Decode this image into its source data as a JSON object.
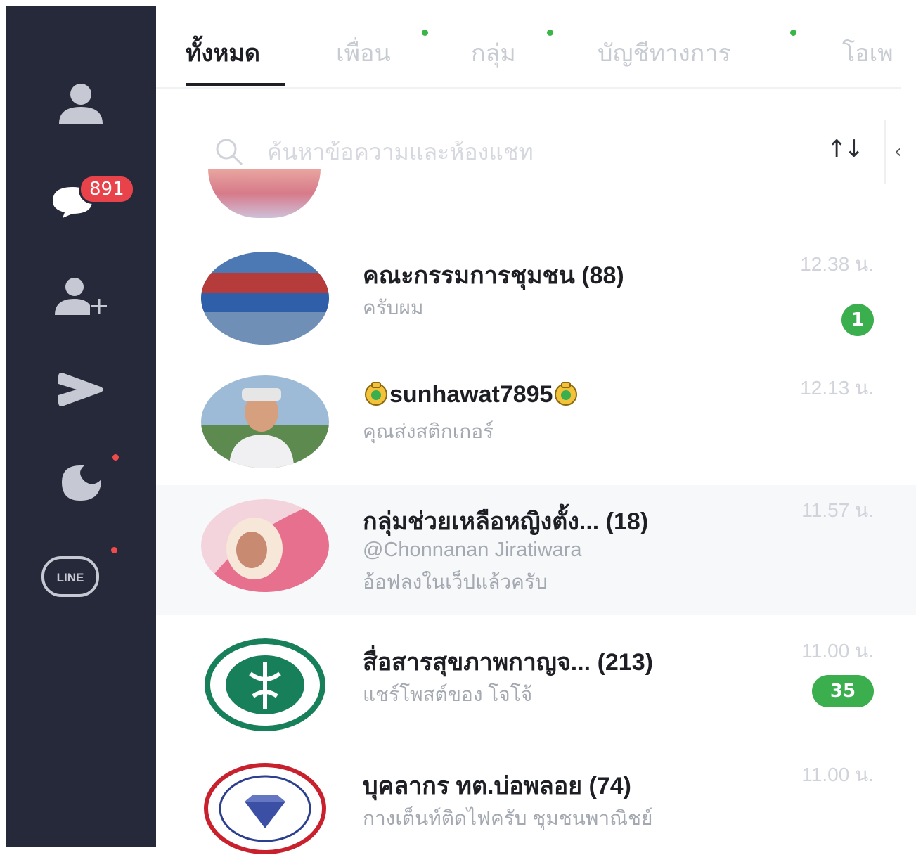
{
  "sidebar": {
    "chats_badge": "891",
    "line_logo_text": "LINE"
  },
  "tabs": [
    {
      "label": "ทั้งหมด"
    },
    {
      "label": "เพื่อน"
    },
    {
      "label": "กลุ่ม"
    },
    {
      "label": "บัญชีทางการ"
    },
    {
      "label": "โอเพ"
    }
  ],
  "search": {
    "placeholder": "ค้นหาข้อความและห้องแชท"
  },
  "chats": [
    {
      "name": "คณะกรรมการชุมชน",
      "count": "(88)",
      "preview": "ครับผม",
      "time": "12.38 น.",
      "unread": "1"
    },
    {
      "name": "sunhawat7895",
      "preview": "คุณส่งสติกเกอร์",
      "time": "12.13 น."
    },
    {
      "name": "กลุ่มช่วยเหลือหญิงตั้ง...",
      "count": "(18)",
      "mention": "@Chonnanan Jiratiwara",
      "preview": "อ้อฟลงในเว็ปแล้วครับ",
      "time": "11.57 น."
    },
    {
      "name": "สื่อสารสุขภาพกาญจ...",
      "count": "(213)",
      "preview": "แชร์โพสต์ของ โจโจ้",
      "time": "11.00 น.",
      "unread": "35"
    },
    {
      "name": "บุคลากร ทต.บ่อพลอย",
      "count": "(74)",
      "preview": "กางเต็นท์ติดไฟครับ ชุมชนพาณิชย์",
      "time": "11.00 น."
    }
  ]
}
